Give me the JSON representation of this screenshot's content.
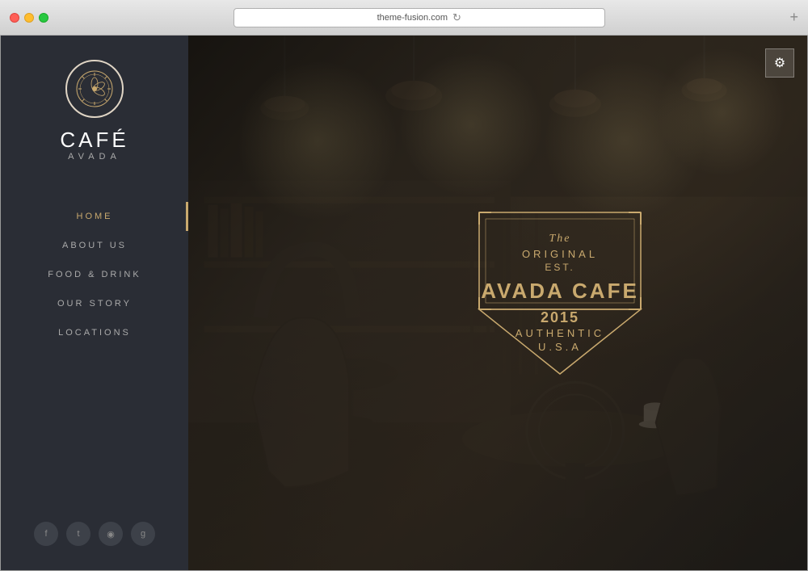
{
  "browser": {
    "url": "theme-fusion.com",
    "new_tab_icon": "+"
  },
  "sidebar": {
    "logo": {
      "icon": "☀",
      "name": "CAFÉ",
      "subtitle": "AVADA"
    },
    "nav": [
      {
        "id": "home",
        "label": "HOME",
        "active": true
      },
      {
        "id": "about",
        "label": "ABOUT US",
        "active": false
      },
      {
        "id": "food",
        "label": "FOOD & DRINK",
        "active": false
      },
      {
        "id": "story",
        "label": "OUR STORY",
        "active": false
      },
      {
        "id": "locations",
        "label": "LOCATIONS",
        "active": false
      }
    ],
    "social": [
      "f",
      "t",
      "◉",
      "g+"
    ]
  },
  "badge": {
    "the": "The",
    "original": "ORIGINAL",
    "est": "EST.",
    "name": "AVADA CAFE",
    "year": "2015",
    "authentic": "AUTHENTIC",
    "usa": "U.S.A"
  },
  "gear_label": "⚙"
}
